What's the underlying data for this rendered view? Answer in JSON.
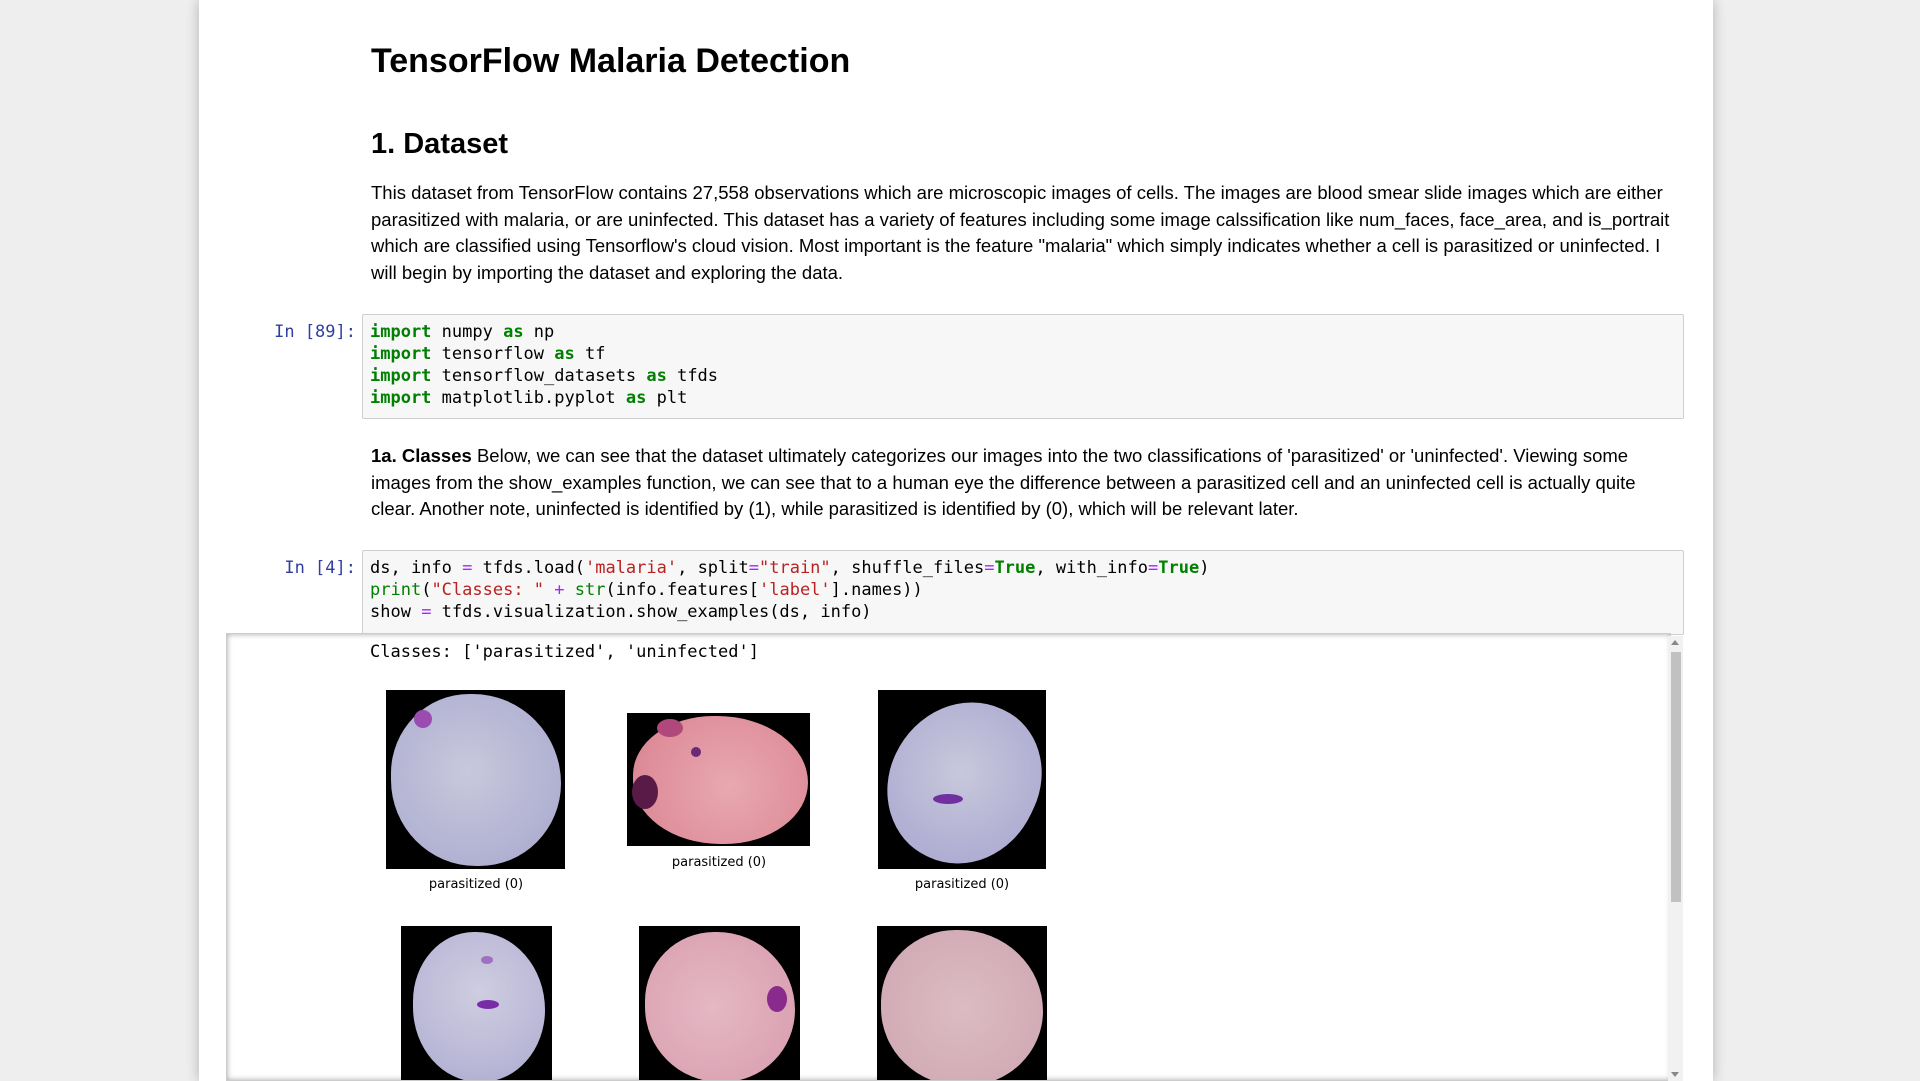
{
  "notebook": {
    "title": "TensorFlow Malaria Detection",
    "section_heading": "1. Dataset",
    "intro_paragraph": "This dataset from TensorFlow contains 27,558 observations which are microscopic images of cells. The images are blood smear slide images which are either parasitized with malaria, or are uninfected. This dataset has a variety of features including some image calssification like num_faces, face_area, and is_portrait which are classified using Tensorflow's cloud vision. Most important is the feature \"malaria\" which simply indicates whether a cell is parasitized or uninfected. I will begin by importing the dataset and exploring the data.",
    "cell1": {
      "prompt": "In [89]:",
      "lines": [
        [
          "import",
          " numpy ",
          "as",
          " np"
        ],
        [
          "import",
          " tensorflow ",
          "as",
          " tf"
        ],
        [
          "import",
          " tensorflow_datasets ",
          "as",
          " tfds"
        ],
        [
          "import",
          " matplotlib.pyplot ",
          "as",
          " plt"
        ]
      ]
    },
    "classes_heading": "1a. Classes",
    "classes_paragraph": " Below, we can see that the dataset ultimately categorizes our images into the two classifications of 'parasitized' or 'uninfected'. Viewing some images from the show_examples function, we can see that to a human eye the difference between a parasitized cell and an uninfected cell is actually quite clear. Another note, uninfected is identified by (1), while parasitized is identified by (0), which will be relevant later.",
    "cell2": {
      "prompt": "In [4]:",
      "line1": {
        "a": "ds, info ",
        "eq": "=",
        "b": " tfds.load(",
        "s1": "'malaria'",
        "c": ", split",
        "eq2": "=",
        "s2": "\"train\"",
        "d": ", shuffle_files",
        "eq3": "=",
        "t1": "True",
        "e": ", with_info",
        "eq4": "=",
        "t2": "True",
        "f": ")"
      },
      "line2": {
        "fn": "print",
        "a": "(",
        "s1": "\"Classes: \"",
        "op": " + ",
        "fn2": "str",
        "b": "(info.features[",
        "s2": "'label'",
        "c": "].names))"
      },
      "line3": {
        "a": "show ",
        "eq": "=",
        "b": " tfds.visualization.show_examples(ds, info)"
      }
    },
    "output": {
      "text": "Classes: ['parasitized', 'uninfected']",
      "captions": [
        "parasitized (0)",
        "parasitized (0)",
        "parasitized (0)"
      ]
    }
  }
}
